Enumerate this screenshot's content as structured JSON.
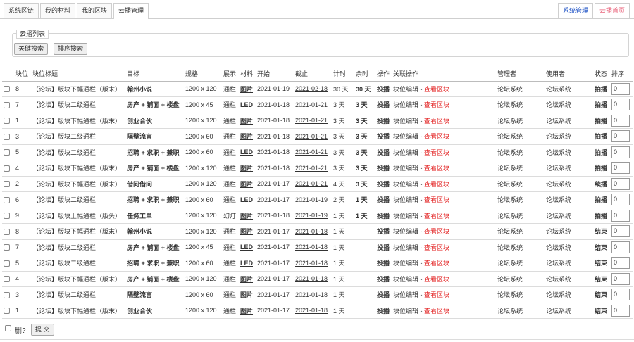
{
  "tabs": [
    {
      "label": "系统区链",
      "active": false
    },
    {
      "label": "我的材料",
      "active": false
    },
    {
      "label": "我的区块",
      "active": false
    },
    {
      "label": "云播管理",
      "active": true
    }
  ],
  "right_tabs": [
    {
      "label": "系统管理",
      "color": "#1a4fc4"
    },
    {
      "label": "云播首页",
      "color": "#e8627a"
    }
  ],
  "panel": {
    "legend": "云播列表",
    "keyword_search": "关健搜索",
    "sort_search": "排序搜索"
  },
  "columns": [
    "块位",
    "块位标题",
    "目标",
    "规格",
    "展示",
    "材料",
    "开始",
    "截止",
    "计时",
    "余时",
    "操作",
    "关联操作",
    "管理者",
    "使用者",
    "状态",
    "排序"
  ],
  "rows": [
    {
      "slot": "8",
      "title": "【论坛】版块下幅通栏（版末）",
      "target": "翰州小说",
      "size": "1200 x 120",
      "show": "通栏",
      "mat": "图片",
      "start": "2021-01-19",
      "end": "2021-02-18",
      "timer": "30 天",
      "remain": "30 天",
      "op": "投播",
      "rel1": "块位编辑",
      "rel2": "查看区块",
      "admin": "论坛系统",
      "user": "论坛系统",
      "status": "拍播",
      "status_type": "shoot",
      "order": "0"
    },
    {
      "slot": "7",
      "title": "【论坛】版块二级通栏",
      "target": "房产 + 铺面 + 楼盘",
      "size": "1200 x 45",
      "show": "通栏",
      "mat": "LED",
      "start": "2021-01-18",
      "end": "2021-01-21",
      "timer": "3 天",
      "remain": "3 天",
      "op": "投播",
      "rel1": "块位编辑",
      "rel2": "查看区块",
      "admin": "论坛系统",
      "user": "论坛系统",
      "status": "拍播",
      "status_type": "shoot",
      "order": "0"
    },
    {
      "slot": "1",
      "title": "【论坛】版块下幅通栏（版末）",
      "target": "创业合伙",
      "size": "1200 x 120",
      "show": "通栏",
      "mat": "图片",
      "start": "2021-01-18",
      "end": "2021-01-21",
      "timer": "3 天",
      "remain": "3 天",
      "op": "投播",
      "rel1": "块位编辑",
      "rel2": "查看区块",
      "admin": "论坛系统",
      "user": "论坛系统",
      "status": "拍播",
      "status_type": "shoot",
      "order": "0"
    },
    {
      "slot": "3",
      "title": "【论坛】版块二级通栏",
      "target": "隔壁流言",
      "size": "1200 x 60",
      "show": "通栏",
      "mat": "图片",
      "start": "2021-01-18",
      "end": "2021-01-21",
      "timer": "3 天",
      "remain": "3 天",
      "op": "投播",
      "rel1": "块位编辑",
      "rel2": "查看区块",
      "admin": "论坛系统",
      "user": "论坛系统",
      "status": "拍播",
      "status_type": "shoot",
      "order": "0"
    },
    {
      "slot": "5",
      "title": "【论坛】版块二级通栏",
      "target": "招聘 + 求职 + 兼职",
      "size": "1200 x 60",
      "show": "通栏",
      "mat": "LED",
      "start": "2021-01-18",
      "end": "2021-01-21",
      "timer": "3 天",
      "remain": "3 天",
      "op": "投播",
      "rel1": "块位编辑",
      "rel2": "查看区块",
      "admin": "论坛系统",
      "user": "论坛系统",
      "status": "拍播",
      "status_type": "shoot",
      "order": "0"
    },
    {
      "slot": "4",
      "title": "【论坛】版块下幅通栏（版末）",
      "target": "房产 + 铺面 + 楼盘",
      "size": "1200 x 120",
      "show": "通栏",
      "mat": "图片",
      "start": "2021-01-18",
      "end": "2021-01-21",
      "timer": "3 天",
      "remain": "3 天",
      "op": "投播",
      "rel1": "块位编辑",
      "rel2": "查看区块",
      "admin": "论坛系统",
      "user": "论坛系统",
      "status": "拍播",
      "status_type": "shoot",
      "order": "0"
    },
    {
      "slot": "2",
      "title": "【论坛】版块下幅通栏（版末）",
      "target": "借问借问",
      "size": "1200 x 120",
      "show": "通栏",
      "mat": "图片",
      "start": "2021-01-17",
      "end": "2021-01-21",
      "timer": "4 天",
      "remain": "3 天",
      "op": "投播",
      "rel1": "块位编辑",
      "rel2": "查看区块",
      "admin": "论坛系统",
      "user": "论坛系统",
      "status": "续播",
      "status_type": "cont",
      "order": "0"
    },
    {
      "slot": "6",
      "title": "【论坛】版块二级通栏",
      "target": "招聘 + 求职 + 兼职",
      "size": "1200 x 60",
      "show": "通栏",
      "mat": "LED",
      "start": "2021-01-17",
      "end": "2021-01-19",
      "timer": "2 天",
      "remain": "1 天",
      "op": "投播",
      "rel1": "块位编辑",
      "rel2": "查看区块",
      "admin": "论坛系统",
      "user": "论坛系统",
      "status": "拍播",
      "status_type": "shoot",
      "order": "0"
    },
    {
      "slot": "9",
      "title": "【论坛】版块上幅通栏（版头）",
      "target": "任务工单",
      "size": "1200 x 120",
      "show": "幻灯",
      "mat": "图片",
      "start": "2021-01-18",
      "end": "2021-01-19",
      "timer": "1 天",
      "remain": "1 天",
      "op": "投播",
      "rel1": "块位编辑",
      "rel2": "查看区块",
      "admin": "论坛系统",
      "user": "论坛系统",
      "status": "拍播",
      "status_type": "shoot",
      "order": "0"
    },
    {
      "slot": "8",
      "title": "【论坛】版块下幅通栏（版末）",
      "target": "翰州小说",
      "size": "1200 x 120",
      "show": "通栏",
      "mat": "图片",
      "start": "2021-01-17",
      "end": "2021-01-18",
      "timer": "1 天",
      "remain": "",
      "op": "投播",
      "rel1": "块位编辑",
      "rel2": "查看区块",
      "admin": "论坛系统",
      "user": "论坛系统",
      "status": "结束",
      "status_type": "end",
      "order": "0"
    },
    {
      "slot": "7",
      "title": "【论坛】版块二级通栏",
      "target": "房产 + 铺面 + 楼盘",
      "size": "1200 x 45",
      "show": "通栏",
      "mat": "LED",
      "start": "2021-01-17",
      "end": "2021-01-18",
      "timer": "1 天",
      "remain": "",
      "op": "投播",
      "rel1": "块位编辑",
      "rel2": "查看区块",
      "admin": "论坛系统",
      "user": "论坛系统",
      "status": "结束",
      "status_type": "end",
      "order": "0"
    },
    {
      "slot": "5",
      "title": "【论坛】版块二级通栏",
      "target": "招聘 + 求职 + 兼职",
      "size": "1200 x 60",
      "show": "通栏",
      "mat": "LED",
      "start": "2021-01-17",
      "end": "2021-01-18",
      "timer": "1 天",
      "remain": "",
      "op": "投播",
      "rel1": "块位编辑",
      "rel2": "查看区块",
      "admin": "论坛系统",
      "user": "论坛系统",
      "status": "结束",
      "status_type": "end",
      "order": "0"
    },
    {
      "slot": "4",
      "title": "【论坛】版块下幅通栏（版末）",
      "target": "房产 + 铺面 + 楼盘",
      "size": "1200 x 120",
      "show": "通栏",
      "mat": "图片",
      "start": "2021-01-17",
      "end": "2021-01-18",
      "timer": "1 天",
      "remain": "",
      "op": "投播",
      "rel1": "块位编辑",
      "rel2": "查看区块",
      "admin": "论坛系统",
      "user": "论坛系统",
      "status": "结束",
      "status_type": "end",
      "order": "0"
    },
    {
      "slot": "3",
      "title": "【论坛】版块二级通栏",
      "target": "隔壁流言",
      "size": "1200 x 60",
      "show": "通栏",
      "mat": "图片",
      "start": "2021-01-17",
      "end": "2021-01-18",
      "timer": "1 天",
      "remain": "",
      "op": "投播",
      "rel1": "块位编辑",
      "rel2": "查看区块",
      "admin": "论坛系统",
      "user": "论坛系统",
      "status": "结束",
      "status_type": "end",
      "order": "0"
    },
    {
      "slot": "1",
      "title": "【论坛】版块下幅通栏（版末）",
      "target": "创业合伙",
      "size": "1200 x 120",
      "show": "通栏",
      "mat": "图片",
      "start": "2021-01-17",
      "end": "2021-01-18",
      "timer": "1 天",
      "remain": "",
      "op": "投播",
      "rel1": "块位编辑",
      "rel2": "查看区块",
      "admin": "论坛系统",
      "user": "论坛系统",
      "status": "结束",
      "status_type": "end",
      "order": "0"
    }
  ],
  "footer": {
    "delete_label": "删?",
    "submit": "提 交"
  }
}
